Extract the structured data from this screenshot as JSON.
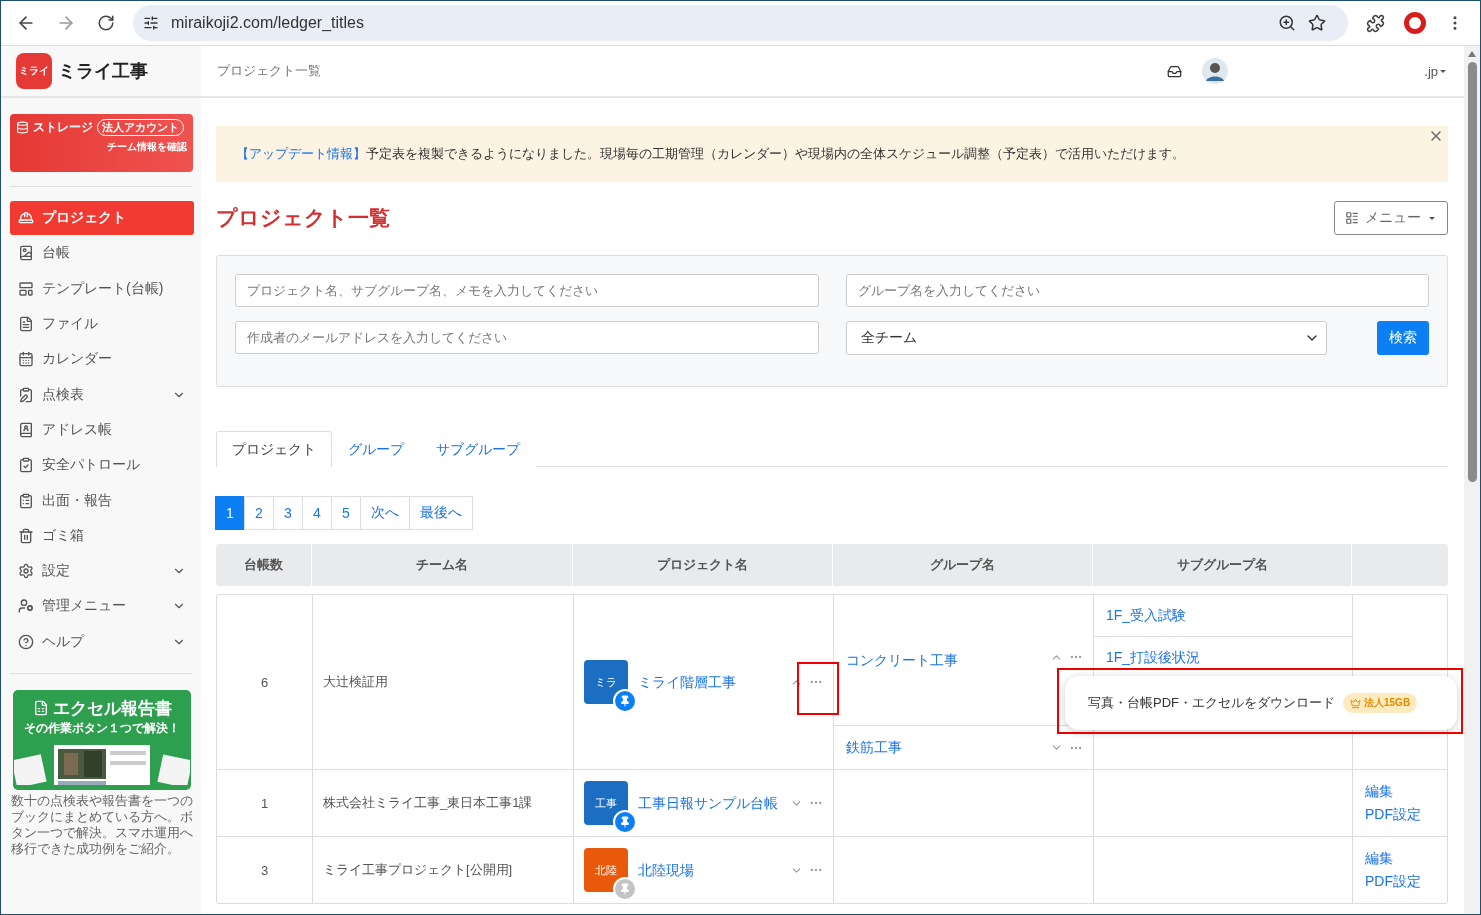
{
  "browser": {
    "url": "miraikoji2.com/ledger_titles"
  },
  "app": {
    "logo_badge": "ミライ",
    "logo_text": "ミライ工事"
  },
  "storage_card": {
    "title": "ストレージ",
    "plan": "法人アカウント",
    "link": "チーム情報を確認"
  },
  "sidebar": {
    "items": [
      {
        "label": "プロジェクト",
        "selected": true,
        "expandable": false
      },
      {
        "label": "台帳",
        "selected": false,
        "expandable": false
      },
      {
        "label": "テンプレート(台帳)",
        "selected": false,
        "expandable": false
      },
      {
        "label": "ファイル",
        "selected": false,
        "expandable": false
      },
      {
        "label": "カレンダー",
        "selected": false,
        "expandable": false
      },
      {
        "label": "点検表",
        "selected": false,
        "expandable": true
      },
      {
        "label": "アドレス帳",
        "selected": false,
        "expandable": false
      },
      {
        "label": "安全パトロール",
        "selected": false,
        "expandable": false
      },
      {
        "label": "出面・報告",
        "selected": false,
        "expandable": false
      },
      {
        "label": "ゴミ箱",
        "selected": false,
        "expandable": false
      },
      {
        "label": "設定",
        "selected": false,
        "expandable": true
      },
      {
        "label": "管理メニュー",
        "selected": false,
        "expandable": true
      },
      {
        "label": "ヘルプ",
        "selected": false,
        "expandable": true
      }
    ]
  },
  "promo": {
    "title": "エクセル報告書",
    "subtitle": "その作業ボタン１つで解決！",
    "text": "数十の点検表や報告書を一つのブックにまとめている方へ。ボタン一つで解決。スマホ運用へ移行できた成功例をご紹介。"
  },
  "header": {
    "breadcrumb": "プロジェクト一覧",
    "account": ".jp"
  },
  "notice": {
    "tag": "【アップデート情報】",
    "text": "予定表を複製できるようになりました。現場毎の工期管理（カレンダー）や現場内の全体スケジュール調整（予定表）で活用いただけます。"
  },
  "page_title": "プロジェクト一覧",
  "menu_button": "メニュー",
  "search": {
    "fields": [
      {
        "placeholder": "プロジェクト名、サブグループ名、メモを入力してください"
      },
      {
        "placeholder": "グループ名を入力してください"
      },
      {
        "placeholder": "作成者のメールアドレスを入力してください"
      }
    ],
    "team_select": "全チーム",
    "button": "検索"
  },
  "tabs": [
    {
      "label": "プロジェクト",
      "selected": true
    },
    {
      "label": "グループ",
      "selected": false
    },
    {
      "label": "サブグループ",
      "selected": false
    }
  ],
  "pagination": [
    {
      "label": "1",
      "selected": true
    },
    {
      "label": "2",
      "selected": false
    },
    {
      "label": "3",
      "selected": false
    },
    {
      "label": "4",
      "selected": false
    },
    {
      "label": "5",
      "selected": false
    },
    {
      "label": "次へ",
      "selected": false
    },
    {
      "label": "最後へ",
      "selected": false
    }
  ],
  "table": {
    "columns": [
      "台帳数",
      "チーム名",
      "プロジェクト名",
      "グループ名",
      "サブグループ名"
    ],
    "rows": [
      {
        "count": "6",
        "team": "大辻検証用",
        "project": {
          "badge": "ミラ",
          "color": "#1b6ec2",
          "pinned": true,
          "name": "ミライ階層工事",
          "expanded": true
        },
        "groups": [
          {
            "name": "コンクリート工事",
            "expanded": true,
            "subgroups": [
              "1F_受入試験",
              "1F_打設後状況"
            ]
          },
          {
            "name": "鉄筋工事",
            "expanded": false
          }
        ]
      },
      {
        "count": "1",
        "team": "株式会社ミライ工事_東日本工事1課",
        "project": {
          "badge": "工事",
          "color": "#1b6ec2",
          "pinned": true,
          "name": "工事日報サンプル台帳",
          "expanded": false
        },
        "actions": [
          "編集",
          "PDF設定"
        ]
      },
      {
        "count": "3",
        "team": "ミライ工事プロジェクト[公開用]",
        "project": {
          "badge": "北陸",
          "color": "#e8590c",
          "pinned": false,
          "name": "北陸現場",
          "expanded": false
        },
        "actions": [
          "編集",
          "PDF設定"
        ]
      }
    ]
  },
  "popup": {
    "text": "写真・台帳PDF・エクセルをダウンロード",
    "badge": "法人15GB"
  }
}
